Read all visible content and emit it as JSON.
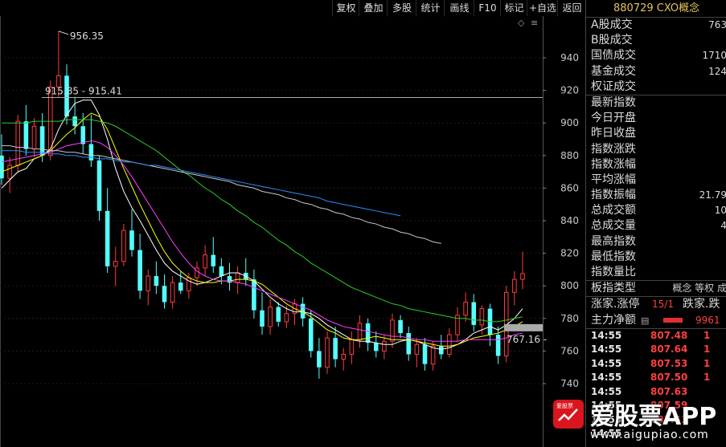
{
  "toolbar": {
    "buttons": [
      "复权",
      "叠加",
      "多股",
      "统计",
      "画线",
      "F10",
      "标记",
      "+自选",
      "返回"
    ]
  },
  "panel": {
    "title": "880729 CXO概念",
    "rows": [
      {
        "label": "A股成交",
        "value": "763"
      },
      {
        "label": "B股成交",
        "value": ""
      },
      {
        "label": "国债成交",
        "value": "1710"
      },
      {
        "label": "基金成交",
        "value": "124"
      },
      {
        "label": "权证成交",
        "value": ""
      },
      {
        "label": "最新指数",
        "value": ""
      },
      {
        "label": "今日开盘",
        "value": ""
      },
      {
        "label": "昨日收盘",
        "value": ""
      },
      {
        "label": "指数涨跌",
        "value": ""
      },
      {
        "label": "指数涨幅",
        "value": ""
      },
      {
        "label": "平均涨幅",
        "value": ""
      },
      {
        "label": "指数振幅",
        "value": "21.79"
      },
      {
        "label": "总成交额",
        "value": "10"
      },
      {
        "label": "总成交量",
        "value": "4"
      },
      {
        "label": "最高指数",
        "value": ""
      },
      {
        "label": "最低指数",
        "value": ""
      },
      {
        "label": "指数量比",
        "value": ""
      }
    ],
    "sector_type_label": "板指类型",
    "sector_type_value": "概念 等权 成",
    "up_limit_label": "涨家.涨停",
    "up_limit_value": "15/1",
    "down_label": "跌家.跌",
    "main_flow_label": "主力净额",
    "main_flow_value": "9961",
    "ticks": [
      {
        "time": "14:55",
        "price": "807.48",
        "vol": "1"
      },
      {
        "time": "14:55",
        "price": "807.64",
        "vol": "1"
      },
      {
        "time": "14:55",
        "price": "807.53",
        "vol": "1"
      },
      {
        "time": "14:55",
        "price": "807.50",
        "vol": "1"
      },
      {
        "time": "14:55",
        "price": "807.63",
        "vol": ""
      },
      {
        "time": "14:55",
        "price": "807.59",
        "vol": ""
      },
      {
        "time": "14:55",
        "price": "807.53",
        "vol": ""
      },
      {
        "time": "14:55",
        "price": "",
        "vol": ""
      }
    ]
  },
  "watermark": {
    "logo_text": "爱股票",
    "name": "爱股票APP",
    "url": "www.aigupiao.com"
  },
  "chart_data": {
    "type": "candlestick",
    "ylim": [
      730,
      965
    ],
    "y_ticks": [
      740,
      760,
      780,
      800,
      820,
      840,
      860,
      880,
      900,
      920,
      940
    ],
    "annotations": [
      {
        "text": "956.35",
        "value": 956.35
      },
      {
        "text": "915.85 - 915.41",
        "value": 915.6
      },
      {
        "text": "767.16 -",
        "value": 767.16
      }
    ],
    "up_color": "#ff3c3c",
    "down_color": "#54ffff",
    "candles": [
      {
        "o": 880,
        "h": 893,
        "l": 862,
        "c": 866
      },
      {
        "o": 866,
        "h": 879,
        "l": 857,
        "c": 874
      },
      {
        "o": 874,
        "h": 905,
        "l": 870,
        "c": 901
      },
      {
        "o": 901,
        "h": 911,
        "l": 880,
        "c": 884
      },
      {
        "o": 884,
        "h": 903,
        "l": 879,
        "c": 898
      },
      {
        "o": 898,
        "h": 906,
        "l": 876,
        "c": 880
      },
      {
        "o": 880,
        "h": 926,
        "l": 877,
        "c": 922
      },
      {
        "o": 922,
        "h": 956.35,
        "l": 916,
        "c": 929
      },
      {
        "o": 929,
        "h": 936,
        "l": 899,
        "c": 904
      },
      {
        "o": 904,
        "h": 916,
        "l": 893,
        "c": 898
      },
      {
        "o": 898,
        "h": 906,
        "l": 881,
        "c": 887
      },
      {
        "o": 887,
        "h": 905,
        "l": 873,
        "c": 877
      },
      {
        "o": 877,
        "h": 880,
        "l": 840,
        "c": 846
      },
      {
        "o": 846,
        "h": 860,
        "l": 808,
        "c": 812
      },
      {
        "o": 812,
        "h": 824,
        "l": 800,
        "c": 815
      },
      {
        "o": 815,
        "h": 838,
        "l": 812,
        "c": 834
      },
      {
        "o": 834,
        "h": 847,
        "l": 818,
        "c": 822
      },
      {
        "o": 822,
        "h": 832,
        "l": 792,
        "c": 797
      },
      {
        "o": 797,
        "h": 810,
        "l": 788,
        "c": 806
      },
      {
        "o": 806,
        "h": 815,
        "l": 795,
        "c": 800
      },
      {
        "o": 800,
        "h": 807,
        "l": 786,
        "c": 790
      },
      {
        "o": 790,
        "h": 806,
        "l": 786,
        "c": 802
      },
      {
        "o": 802,
        "h": 809,
        "l": 795,
        "c": 797
      },
      {
        "o": 797,
        "h": 808,
        "l": 792,
        "c": 805
      },
      {
        "o": 805,
        "h": 815,
        "l": 800,
        "c": 811
      },
      {
        "o": 811,
        "h": 825,
        "l": 806,
        "c": 819
      },
      {
        "o": 819,
        "h": 830,
        "l": 808,
        "c": 812
      },
      {
        "o": 812,
        "h": 817,
        "l": 801,
        "c": 806
      },
      {
        "o": 806,
        "h": 814,
        "l": 797,
        "c": 802
      },
      {
        "o": 802,
        "h": 812,
        "l": 795,
        "c": 808
      },
      {
        "o": 808,
        "h": 817,
        "l": 800,
        "c": 804
      },
      {
        "o": 804,
        "h": 810,
        "l": 780,
        "c": 785
      },
      {
        "o": 785,
        "h": 796,
        "l": 770,
        "c": 775
      },
      {
        "o": 775,
        "h": 792,
        "l": 770,
        "c": 787
      },
      {
        "o": 787,
        "h": 790,
        "l": 775,
        "c": 778
      },
      {
        "o": 778,
        "h": 788,
        "l": 774,
        "c": 783
      },
      {
        "o": 783,
        "h": 792,
        "l": 776,
        "c": 789
      },
      {
        "o": 789,
        "h": 793,
        "l": 775,
        "c": 780
      },
      {
        "o": 780,
        "h": 785,
        "l": 756,
        "c": 760
      },
      {
        "o": 760,
        "h": 768,
        "l": 743,
        "c": 750
      },
      {
        "o": 750,
        "h": 772,
        "l": 746,
        "c": 768
      },
      {
        "o": 768,
        "h": 775,
        "l": 750,
        "c": 755
      },
      {
        "o": 755,
        "h": 762,
        "l": 748,
        "c": 758
      },
      {
        "o": 758,
        "h": 772,
        "l": 752,
        "c": 767
      },
      {
        "o": 767,
        "h": 782,
        "l": 762,
        "c": 777
      },
      {
        "o": 777,
        "h": 780,
        "l": 760,
        "c": 765
      },
      {
        "o": 765,
        "h": 772,
        "l": 756,
        "c": 760
      },
      {
        "o": 760,
        "h": 770,
        "l": 755,
        "c": 766
      },
      {
        "o": 766,
        "h": 783,
        "l": 762,
        "c": 779
      },
      {
        "o": 779,
        "h": 782,
        "l": 768,
        "c": 771
      },
      {
        "o": 771,
        "h": 775,
        "l": 754,
        "c": 758
      },
      {
        "o": 758,
        "h": 768,
        "l": 750,
        "c": 764
      },
      {
        "o": 764,
        "h": 768,
        "l": 748,
        "c": 752
      },
      {
        "o": 752,
        "h": 766,
        "l": 748,
        "c": 763
      },
      {
        "o": 763,
        "h": 770,
        "l": 755,
        "c": 758
      },
      {
        "o": 758,
        "h": 774,
        "l": 756,
        "c": 770
      },
      {
        "o": 770,
        "h": 787,
        "l": 766,
        "c": 782
      },
      {
        "o": 782,
        "h": 796,
        "l": 778,
        "c": 790
      },
      {
        "o": 790,
        "h": 795,
        "l": 772,
        "c": 776
      },
      {
        "o": 776,
        "h": 788,
        "l": 770,
        "c": 786
      },
      {
        "o": 786,
        "h": 789,
        "l": 763,
        "c": 770
      },
      {
        "o": 770,
        "h": 775,
        "l": 752,
        "c": 757
      },
      {
        "o": 757,
        "h": 800,
        "l": 753,
        "c": 796
      },
      {
        "o": 796,
        "h": 809,
        "l": 788,
        "c": 804
      },
      {
        "o": 804,
        "h": 821,
        "l": 798,
        "c": 807.5
      }
    ],
    "series": [
      {
        "label": "MA-white",
        "color": "#ffffff",
        "values": [
          860,
          865,
          870,
          872,
          878,
          880,
          884,
          896,
          905,
          912,
          914,
          914,
          905,
          890,
          872,
          858,
          848,
          840,
          831,
          822,
          814,
          809,
          806,
          803,
          801,
          802,
          804,
          806,
          808,
          808,
          806,
          803,
          798,
          793,
          789,
          786,
          784,
          784,
          783,
          780,
          776,
          773,
          770,
          767,
          766,
          766,
          765,
          764,
          764,
          766,
          767,
          766,
          764,
          762,
          761,
          762,
          764,
          767,
          771,
          773,
          775,
          773,
          776,
          780,
          786
        ]
      },
      {
        "label": "MA-yellow",
        "color": "#ffff00",
        "values": [
          870,
          872,
          874,
          876,
          878,
          880,
          883,
          888,
          893,
          897,
          902,
          906,
          904,
          896,
          884,
          872,
          861,
          850,
          840,
          830,
          821,
          814,
          809,
          805,
          803,
          802,
          802,
          803,
          803,
          804,
          804,
          803,
          801,
          797,
          793,
          789,
          786,
          784,
          781,
          777,
          773,
          771,
          768,
          767,
          767,
          768,
          769,
          768,
          767,
          767,
          767,
          766,
          765,
          764,
          763,
          763,
          764,
          766,
          768,
          769,
          770,
          771,
          773,
          775,
          778
        ]
      },
      {
        "label": "MA-magenta",
        "color": "#ff40ff",
        "values": [
          876,
          877,
          878,
          879,
          880,
          881,
          882,
          884,
          886,
          887,
          888,
          889,
          888,
          885,
          880,
          874,
          867,
          859,
          851,
          843,
          835,
          827,
          820,
          814,
          809,
          806,
          804,
          803,
          803,
          802,
          801,
          799,
          797,
          795,
          793,
          791,
          789,
          787,
          785,
          782,
          779,
          777,
          775,
          774,
          773,
          772,
          771,
          770,
          769,
          769,
          768,
          767,
          767,
          766,
          766,
          766,
          766,
          767,
          767,
          767,
          767,
          767,
          768,
          770,
          771
        ]
      },
      {
        "label": "MA-green",
        "color": "#28d028",
        "values": [
          900,
          900,
          900,
          900,
          901,
          901,
          901,
          901,
          902,
          902,
          902,
          902,
          901,
          900,
          898,
          895,
          892,
          889,
          886,
          883,
          879,
          875,
          871,
          868,
          864,
          860,
          857,
          853,
          850,
          846,
          843,
          839,
          836,
          832,
          828,
          825,
          821,
          818,
          814,
          811,
          808,
          805,
          802,
          799,
          797,
          795,
          793,
          791,
          789,
          788,
          786,
          785,
          784,
          783,
          782,
          781,
          780,
          780,
          779,
          779,
          778,
          778,
          779,
          780,
          781
        ]
      },
      {
        "label": "MA-grey",
        "color": "#c8c8c8",
        "values": [
          886,
          886,
          885,
          885,
          884,
          884,
          883,
          883,
          882,
          882,
          881,
          880,
          880,
          879,
          878,
          877,
          876,
          875,
          874,
          873,
          872,
          871,
          870,
          869,
          868,
          867,
          866,
          865,
          864,
          862,
          861,
          860,
          858,
          857,
          856,
          854,
          853,
          851,
          850,
          848,
          847,
          845,
          844,
          842,
          841,
          839,
          838,
          836,
          835,
          833,
          832,
          830,
          829,
          827,
          826
        ]
      },
      {
        "label": "MA-blue",
        "color": "#2a8cff",
        "values": [
          883,
          883,
          883,
          882,
          882,
          882,
          881,
          881,
          880,
          880,
          879,
          879,
          878,
          878,
          877,
          876,
          876,
          875,
          874,
          874,
          873,
          872,
          871,
          870,
          869,
          868,
          867,
          866,
          865,
          864,
          863,
          862,
          861,
          860,
          859,
          858,
          857,
          856,
          855,
          854,
          852,
          851,
          850,
          849,
          848,
          847,
          846,
          845,
          844,
          843
        ]
      }
    ]
  }
}
